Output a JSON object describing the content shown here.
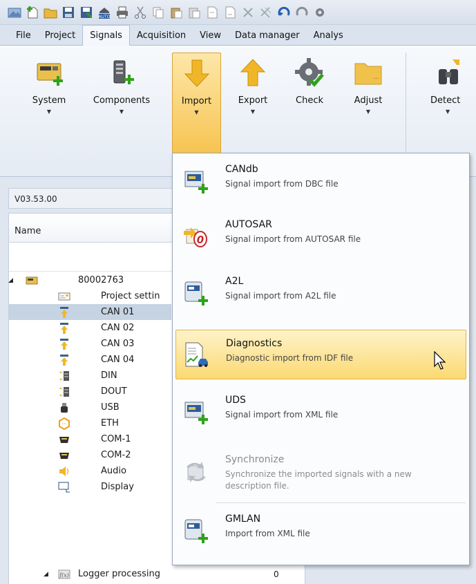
{
  "ribbon_tabs": [
    "File",
    "Project",
    "Signals",
    "Acquisition",
    "View",
    "Data manager",
    "Analys"
  ],
  "active_tab": "Signals",
  "ribbon_buttons": {
    "system": "System",
    "components": "Components",
    "import": "Import",
    "export": "Export",
    "check": "Check",
    "adjust": "Adjust",
    "detect": "Detect"
  },
  "version": "V03.53.00",
  "grid": {
    "name_header": "Name",
    "rows": [
      {
        "label": "80002763",
        "icon": "device-icon"
      },
      {
        "label": "Project settin",
        "icon": "settings-card-icon"
      },
      {
        "label": "CAN 01",
        "icon": "can-icon",
        "selected": true
      },
      {
        "label": "CAN 02",
        "icon": "can-icon"
      },
      {
        "label": "CAN 03",
        "icon": "can-icon"
      },
      {
        "label": "CAN 04",
        "icon": "can-icon"
      },
      {
        "label": "DIN",
        "icon": "din-icon"
      },
      {
        "label": "DOUT",
        "icon": "dout-icon"
      },
      {
        "label": "USB",
        "icon": "usb-icon"
      },
      {
        "label": "ETH",
        "icon": "eth-icon"
      },
      {
        "label": "COM-1",
        "icon": "com-icon"
      },
      {
        "label": "COM-2",
        "icon": "com-icon"
      },
      {
        "label": "Audio",
        "icon": "audio-icon"
      },
      {
        "label": "Display",
        "icon": "display-icon"
      },
      {
        "label": "Logger processing",
        "icon": "function-icon",
        "value": "0"
      }
    ]
  },
  "import_menu": {
    "candb": {
      "title": "CANdb",
      "desc": "Signal import from DBC file"
    },
    "autosar": {
      "title": "AUTOSAR",
      "desc": "Signal import from AUTOSAR file"
    },
    "a2l": {
      "title": "A2L",
      "desc": "Signal import from A2L file"
    },
    "diagnostics": {
      "title": "Diagnostics",
      "desc": "Diagnostic import from IDF file"
    },
    "uds": {
      "title": "UDS",
      "desc": "Signal import from XML file"
    },
    "synchronize": {
      "title": "Synchronize",
      "desc": "Synchronize the imported signals with a new description file."
    },
    "gmlan": {
      "title": "GMLAN",
      "desc": "Import from XML file"
    }
  },
  "colors": {
    "accent": "#f7c24d",
    "hover": "#fbd972",
    "selection": "#c6d3e3"
  }
}
